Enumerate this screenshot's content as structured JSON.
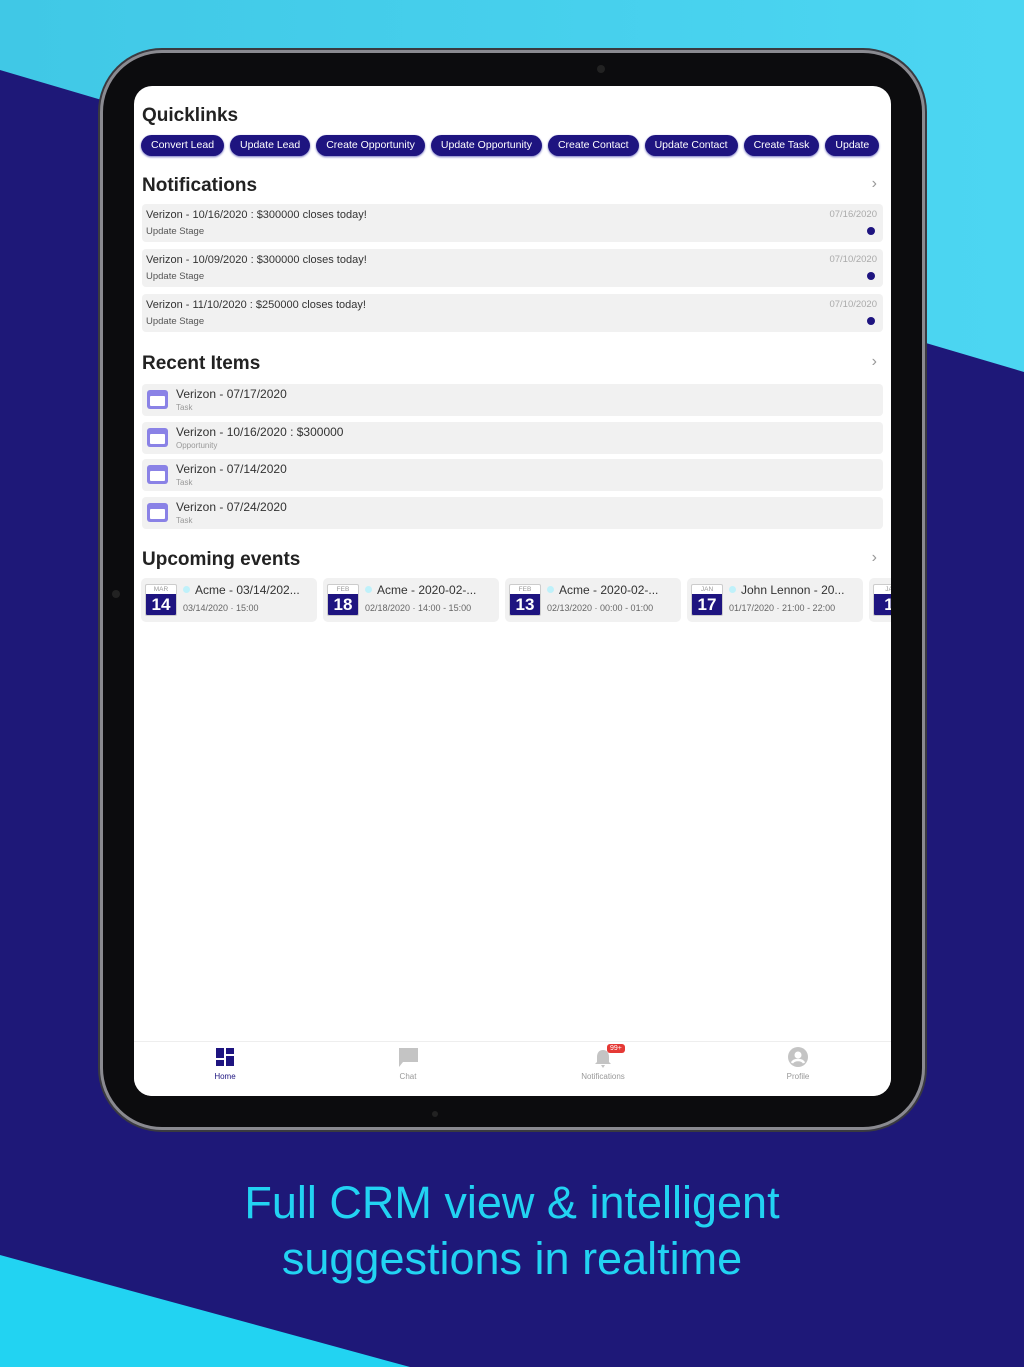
{
  "colors": {
    "brand": "#1e1480",
    "background": "#1e1878",
    "accent": "#22d3f2",
    "badge": "#e53935"
  },
  "quicklinks": {
    "title": "Quicklinks",
    "items": [
      "Convert Lead",
      "Update Lead",
      "Create Opportunity",
      "Update Opportunity",
      "Create Contact",
      "Update Contact",
      "Create Task",
      "Update"
    ]
  },
  "notifications": {
    "title": "Notifications",
    "items": [
      {
        "title": "Verizon - 10/16/2020 : $300000 closes today!",
        "sub": "Update Stage",
        "date": "07/16/2020",
        "unread": true
      },
      {
        "title": "Verizon - 10/09/2020 : $300000 closes today!",
        "sub": "Update Stage",
        "date": "07/10/2020",
        "unread": true
      },
      {
        "title": "Verizon - 11/10/2020 : $250000 closes today!",
        "sub": "Update Stage",
        "date": "07/10/2020",
        "unread": true
      }
    ]
  },
  "recent": {
    "title": "Recent Items",
    "items": [
      {
        "title": "Verizon - 07/17/2020",
        "type": "Task"
      },
      {
        "title": "Verizon - 10/16/2020 : $300000",
        "type": "Opportunity"
      },
      {
        "title": "Verizon - 07/14/2020",
        "type": "Task"
      },
      {
        "title": "Verizon - 07/24/2020",
        "type": "Task"
      }
    ]
  },
  "events": {
    "title": "Upcoming events",
    "items": [
      {
        "month": "MAR",
        "day": "14",
        "title": "Acme - 03/14/202...",
        "sub": "03/14/2020  ·  15:00"
      },
      {
        "month": "FEB",
        "day": "18",
        "title": "Acme - 2020-02-...",
        "sub": "02/18/2020  ·  14:00 - 15:00"
      },
      {
        "month": "FEB",
        "day": "13",
        "title": "Acme - 2020-02-...",
        "sub": "02/13/2020  ·  00:00 - 01:00"
      },
      {
        "month": "JAN",
        "day": "17",
        "title": "John Lennon - 20...",
        "sub": "01/17/2020  ·  21:00 - 22:00"
      },
      {
        "month": "JA",
        "day": "1",
        "title": "",
        "sub": ""
      }
    ]
  },
  "tabbar": {
    "items": [
      {
        "label": "Home",
        "icon": "dashboard-icon",
        "active": true
      },
      {
        "label": "Chat",
        "icon": "chat-icon"
      },
      {
        "label": "Notifications",
        "icon": "bell-icon",
        "badge": "99+"
      },
      {
        "label": "Profile",
        "icon": "profile-icon"
      }
    ]
  },
  "tagline": {
    "line1": "Full CRM view & intelligent",
    "line2": "suggestions in realtime"
  }
}
